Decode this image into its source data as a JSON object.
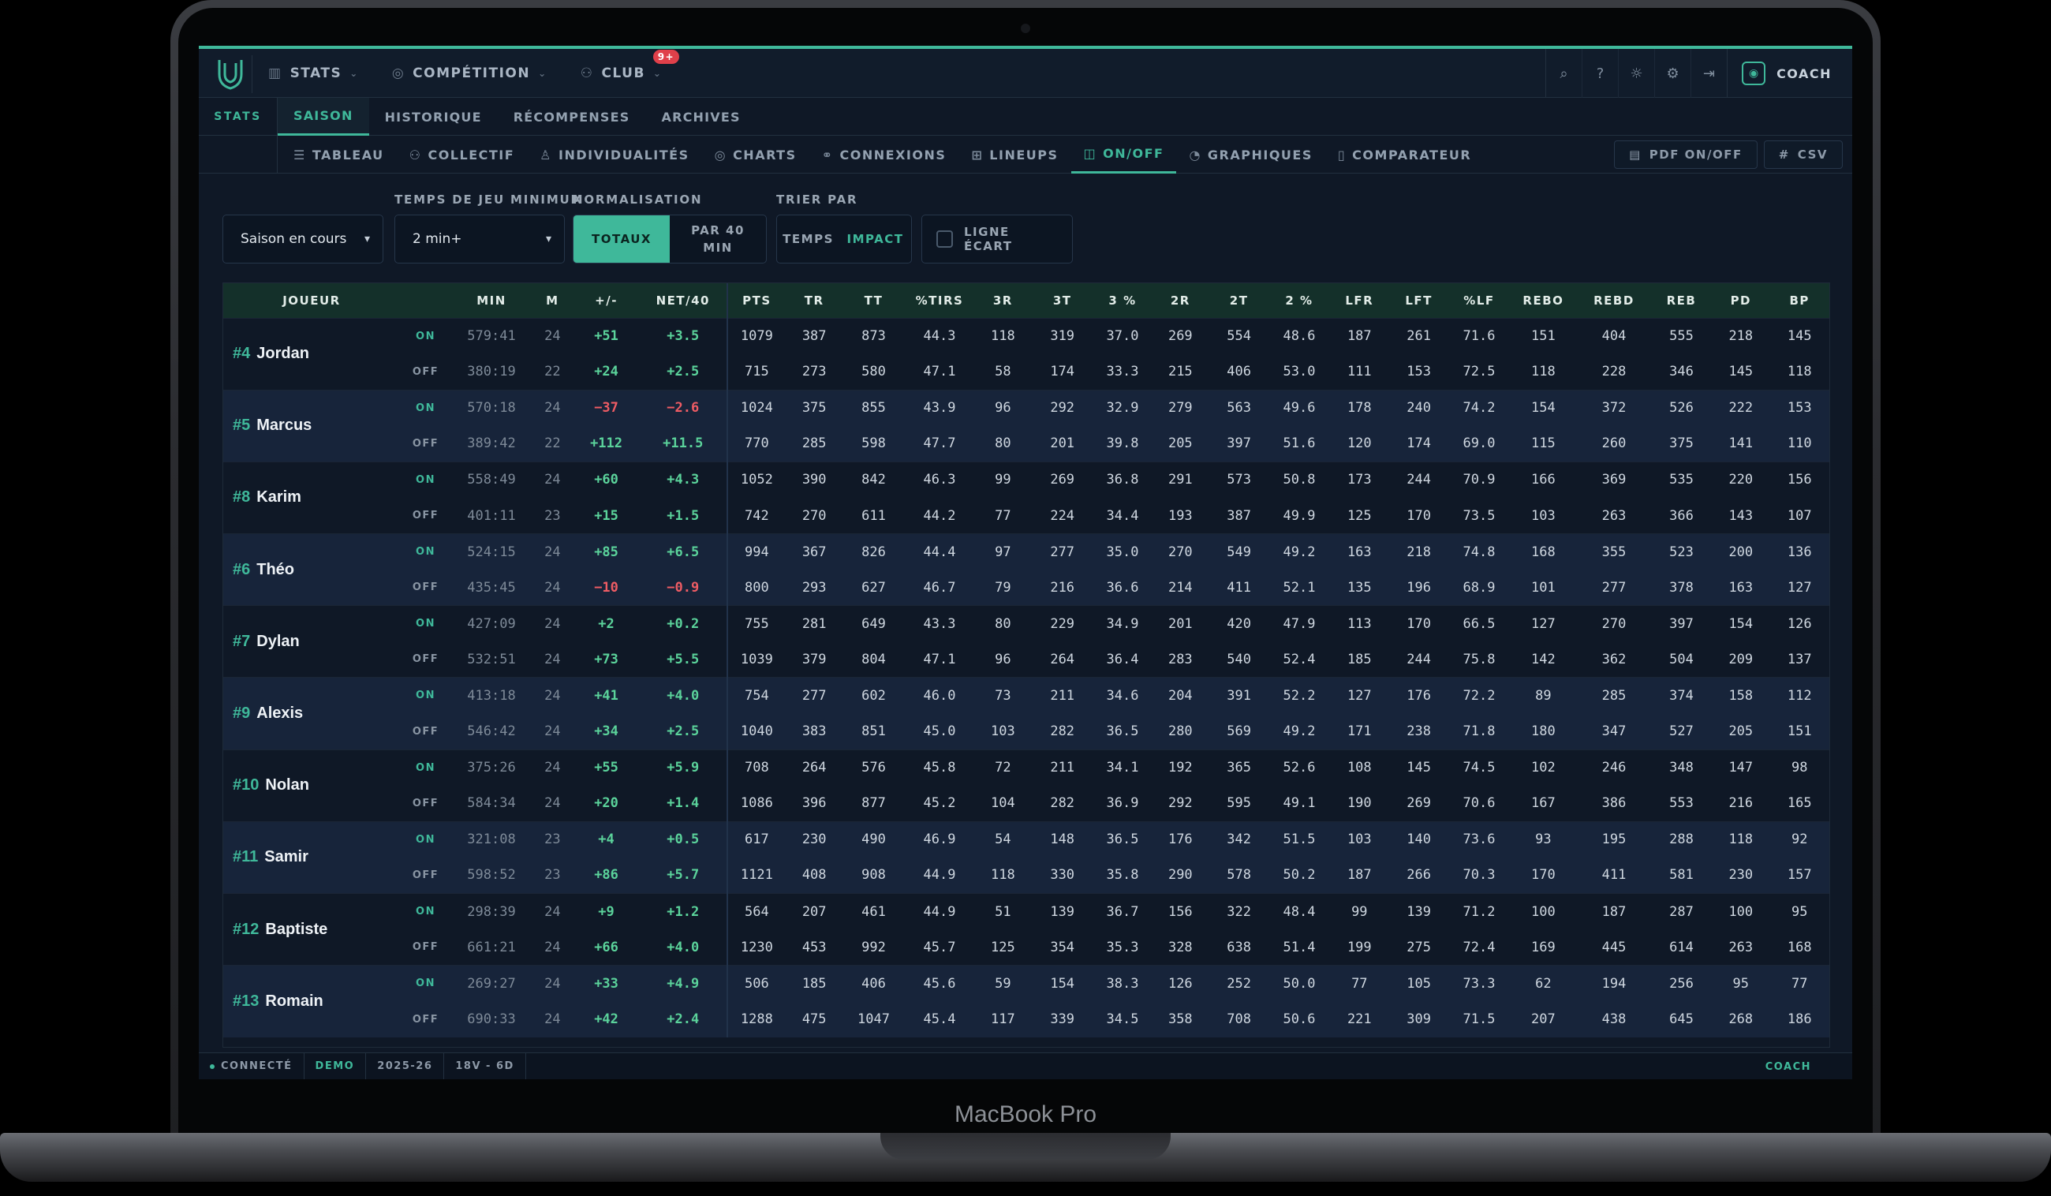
{
  "device": {
    "brand": "MacBook Pro"
  },
  "topbar": {
    "nav": [
      {
        "label": "STATS",
        "icon": "bar-chart-icon"
      },
      {
        "label": "COMPÉTITION",
        "icon": "trophy-icon"
      },
      {
        "label": "CLUB",
        "icon": "users-icon",
        "badge": "9+"
      }
    ],
    "icons": [
      "search-icon",
      "help-icon",
      "sun-icon",
      "gear-icon",
      "logout-icon"
    ],
    "user": {
      "label": "COACH",
      "icon": "user-icon"
    }
  },
  "subnav": {
    "section": "STATS",
    "tabs": [
      "SAISON",
      "HISTORIQUE",
      "RÉCOMPENSES",
      "ARCHIVES"
    ],
    "active": "SAISON"
  },
  "viewnav": {
    "tabs": [
      {
        "label": "TABLEAU",
        "icon": "list-icon"
      },
      {
        "label": "COLLECTIF",
        "icon": "team-icon"
      },
      {
        "label": "INDIVIDUALITÉS",
        "icon": "person-icon"
      },
      {
        "label": "CHARTS",
        "icon": "target-icon"
      },
      {
        "label": "CONNEXIONS",
        "icon": "link-icon"
      },
      {
        "label": "LINEUPS",
        "icon": "grid-icon"
      },
      {
        "label": "ON/OFF",
        "icon": "split-icon"
      },
      {
        "label": "GRAPHIQUES",
        "icon": "pie-icon"
      },
      {
        "label": "COMPARATEUR",
        "icon": "compare-icon"
      }
    ],
    "active": "ON/OFF",
    "exports": [
      {
        "label": "PDF ON/OFF",
        "icon": "pdf-icon"
      },
      {
        "label": "CSV",
        "icon": "grid-icon"
      }
    ]
  },
  "filters": {
    "season": {
      "value": "Saison en cours"
    },
    "min_time": {
      "label": "TEMPS DE JEU MINIMUM",
      "value": "2 min+"
    },
    "normalisation": {
      "label": "NORMALISATION",
      "options": [
        "TOTAUX",
        "PAR 40 MIN"
      ],
      "active": "TOTAUX"
    },
    "sort": {
      "label": "TRIER PAR",
      "options": [
        "TEMPS",
        "IMPACT"
      ],
      "active": "IMPACT"
    },
    "gap_line": {
      "label": "LIGNE ÉCART"
    }
  },
  "table": {
    "columns": [
      "JOUEUR",
      "",
      "MIN",
      "M",
      "+/-",
      "NET/40",
      "PTS",
      "TR",
      "TT",
      "%TIRS",
      "3R",
      "3T",
      "3 %",
      "2R",
      "2T",
      "2 %",
      "LFR",
      "LFT",
      "%LF",
      "REBO",
      "REBD",
      "REB",
      "PD",
      "BP"
    ],
    "players": [
      {
        "num": "#4",
        "name": "Jordan",
        "on": [
          "579:41",
          "24",
          "+51",
          "+3.5",
          "1079",
          "387",
          "873",
          "44.3",
          "118",
          "319",
          "37.0",
          "269",
          "554",
          "48.6",
          "187",
          "261",
          "71.6",
          "151",
          "404",
          "555",
          "218",
          "145"
        ],
        "off": [
          "380:19",
          "22",
          "+24",
          "+2.5",
          "715",
          "273",
          "580",
          "47.1",
          "58",
          "174",
          "33.3",
          "215",
          "406",
          "53.0",
          "111",
          "153",
          "72.5",
          "118",
          "228",
          "346",
          "145",
          "118"
        ]
      },
      {
        "num": "#5",
        "name": "Marcus",
        "on": [
          "570:18",
          "24",
          "−37",
          "−2.6",
          "1024",
          "375",
          "855",
          "43.9",
          "96",
          "292",
          "32.9",
          "279",
          "563",
          "49.6",
          "178",
          "240",
          "74.2",
          "154",
          "372",
          "526",
          "222",
          "153"
        ],
        "off": [
          "389:42",
          "22",
          "+112",
          "+11.5",
          "770",
          "285",
          "598",
          "47.7",
          "80",
          "201",
          "39.8",
          "205",
          "397",
          "51.6",
          "120",
          "174",
          "69.0",
          "115",
          "260",
          "375",
          "141",
          "110"
        ]
      },
      {
        "num": "#8",
        "name": "Karim",
        "on": [
          "558:49",
          "24",
          "+60",
          "+4.3",
          "1052",
          "390",
          "842",
          "46.3",
          "99",
          "269",
          "36.8",
          "291",
          "573",
          "50.8",
          "173",
          "244",
          "70.9",
          "166",
          "369",
          "535",
          "220",
          "156"
        ],
        "off": [
          "401:11",
          "23",
          "+15",
          "+1.5",
          "742",
          "270",
          "611",
          "44.2",
          "77",
          "224",
          "34.4",
          "193",
          "387",
          "49.9",
          "125",
          "170",
          "73.5",
          "103",
          "263",
          "366",
          "143",
          "107"
        ]
      },
      {
        "num": "#6",
        "name": "Théo",
        "on": [
          "524:15",
          "24",
          "+85",
          "+6.5",
          "994",
          "367",
          "826",
          "44.4",
          "97",
          "277",
          "35.0",
          "270",
          "549",
          "49.2",
          "163",
          "218",
          "74.8",
          "168",
          "355",
          "523",
          "200",
          "136"
        ],
        "off": [
          "435:45",
          "24",
          "−10",
          "−0.9",
          "800",
          "293",
          "627",
          "46.7",
          "79",
          "216",
          "36.6",
          "214",
          "411",
          "52.1",
          "135",
          "196",
          "68.9",
          "101",
          "277",
          "378",
          "163",
          "127"
        ]
      },
      {
        "num": "#7",
        "name": "Dylan",
        "on": [
          "427:09",
          "24",
          "+2",
          "+0.2",
          "755",
          "281",
          "649",
          "43.3",
          "80",
          "229",
          "34.9",
          "201",
          "420",
          "47.9",
          "113",
          "170",
          "66.5",
          "127",
          "270",
          "397",
          "154",
          "126"
        ],
        "off": [
          "532:51",
          "24",
          "+73",
          "+5.5",
          "1039",
          "379",
          "804",
          "47.1",
          "96",
          "264",
          "36.4",
          "283",
          "540",
          "52.4",
          "185",
          "244",
          "75.8",
          "142",
          "362",
          "504",
          "209",
          "137"
        ]
      },
      {
        "num": "#9",
        "name": "Alexis",
        "on": [
          "413:18",
          "24",
          "+41",
          "+4.0",
          "754",
          "277",
          "602",
          "46.0",
          "73",
          "211",
          "34.6",
          "204",
          "391",
          "52.2",
          "127",
          "176",
          "72.2",
          "89",
          "285",
          "374",
          "158",
          "112"
        ],
        "off": [
          "546:42",
          "24",
          "+34",
          "+2.5",
          "1040",
          "383",
          "851",
          "45.0",
          "103",
          "282",
          "36.5",
          "280",
          "569",
          "49.2",
          "171",
          "238",
          "71.8",
          "180",
          "347",
          "527",
          "205",
          "151"
        ]
      },
      {
        "num": "#10",
        "name": "Nolan",
        "on": [
          "375:26",
          "24",
          "+55",
          "+5.9",
          "708",
          "264",
          "576",
          "45.8",
          "72",
          "211",
          "34.1",
          "192",
          "365",
          "52.6",
          "108",
          "145",
          "74.5",
          "102",
          "246",
          "348",
          "147",
          "98"
        ],
        "off": [
          "584:34",
          "24",
          "+20",
          "+1.4",
          "1086",
          "396",
          "877",
          "45.2",
          "104",
          "282",
          "36.9",
          "292",
          "595",
          "49.1",
          "190",
          "269",
          "70.6",
          "167",
          "386",
          "553",
          "216",
          "165"
        ]
      },
      {
        "num": "#11",
        "name": "Samir",
        "on": [
          "321:08",
          "23",
          "+4",
          "+0.5",
          "617",
          "230",
          "490",
          "46.9",
          "54",
          "148",
          "36.5",
          "176",
          "342",
          "51.5",
          "103",
          "140",
          "73.6",
          "93",
          "195",
          "288",
          "118",
          "92"
        ],
        "off": [
          "598:52",
          "23",
          "+86",
          "+5.7",
          "1121",
          "408",
          "908",
          "44.9",
          "118",
          "330",
          "35.8",
          "290",
          "578",
          "50.2",
          "187",
          "266",
          "70.3",
          "170",
          "411",
          "581",
          "230",
          "157"
        ]
      },
      {
        "num": "#12",
        "name": "Baptiste",
        "on": [
          "298:39",
          "24",
          "+9",
          "+1.2",
          "564",
          "207",
          "461",
          "44.9",
          "51",
          "139",
          "36.7",
          "156",
          "322",
          "48.4",
          "99",
          "139",
          "71.2",
          "100",
          "187",
          "287",
          "100",
          "95"
        ],
        "off": [
          "661:21",
          "24",
          "+66",
          "+4.0",
          "1230",
          "453",
          "992",
          "45.7",
          "125",
          "354",
          "35.3",
          "328",
          "638",
          "51.4",
          "199",
          "275",
          "72.4",
          "169",
          "445",
          "614",
          "263",
          "168"
        ]
      },
      {
        "num": "#13",
        "name": "Romain",
        "on": [
          "269:27",
          "24",
          "+33",
          "+4.9",
          "506",
          "185",
          "406",
          "45.6",
          "59",
          "154",
          "38.3",
          "126",
          "252",
          "50.0",
          "77",
          "105",
          "73.3",
          "62",
          "194",
          "256",
          "95",
          "77"
        ],
        "off": [
          "690:33",
          "24",
          "+42",
          "+2.4",
          "1288",
          "475",
          "1047",
          "45.4",
          "117",
          "339",
          "34.5",
          "358",
          "708",
          "50.6",
          "221",
          "309",
          "71.5",
          "207",
          "438",
          "645",
          "268",
          "186"
        ]
      }
    ],
    "tag_on": "ON",
    "tag_off": "OFF"
  },
  "statusbar": {
    "items": [
      "CONNECTÉ",
      "DEMO",
      "2025-26",
      "18V - 6D"
    ],
    "right": "COACH"
  }
}
